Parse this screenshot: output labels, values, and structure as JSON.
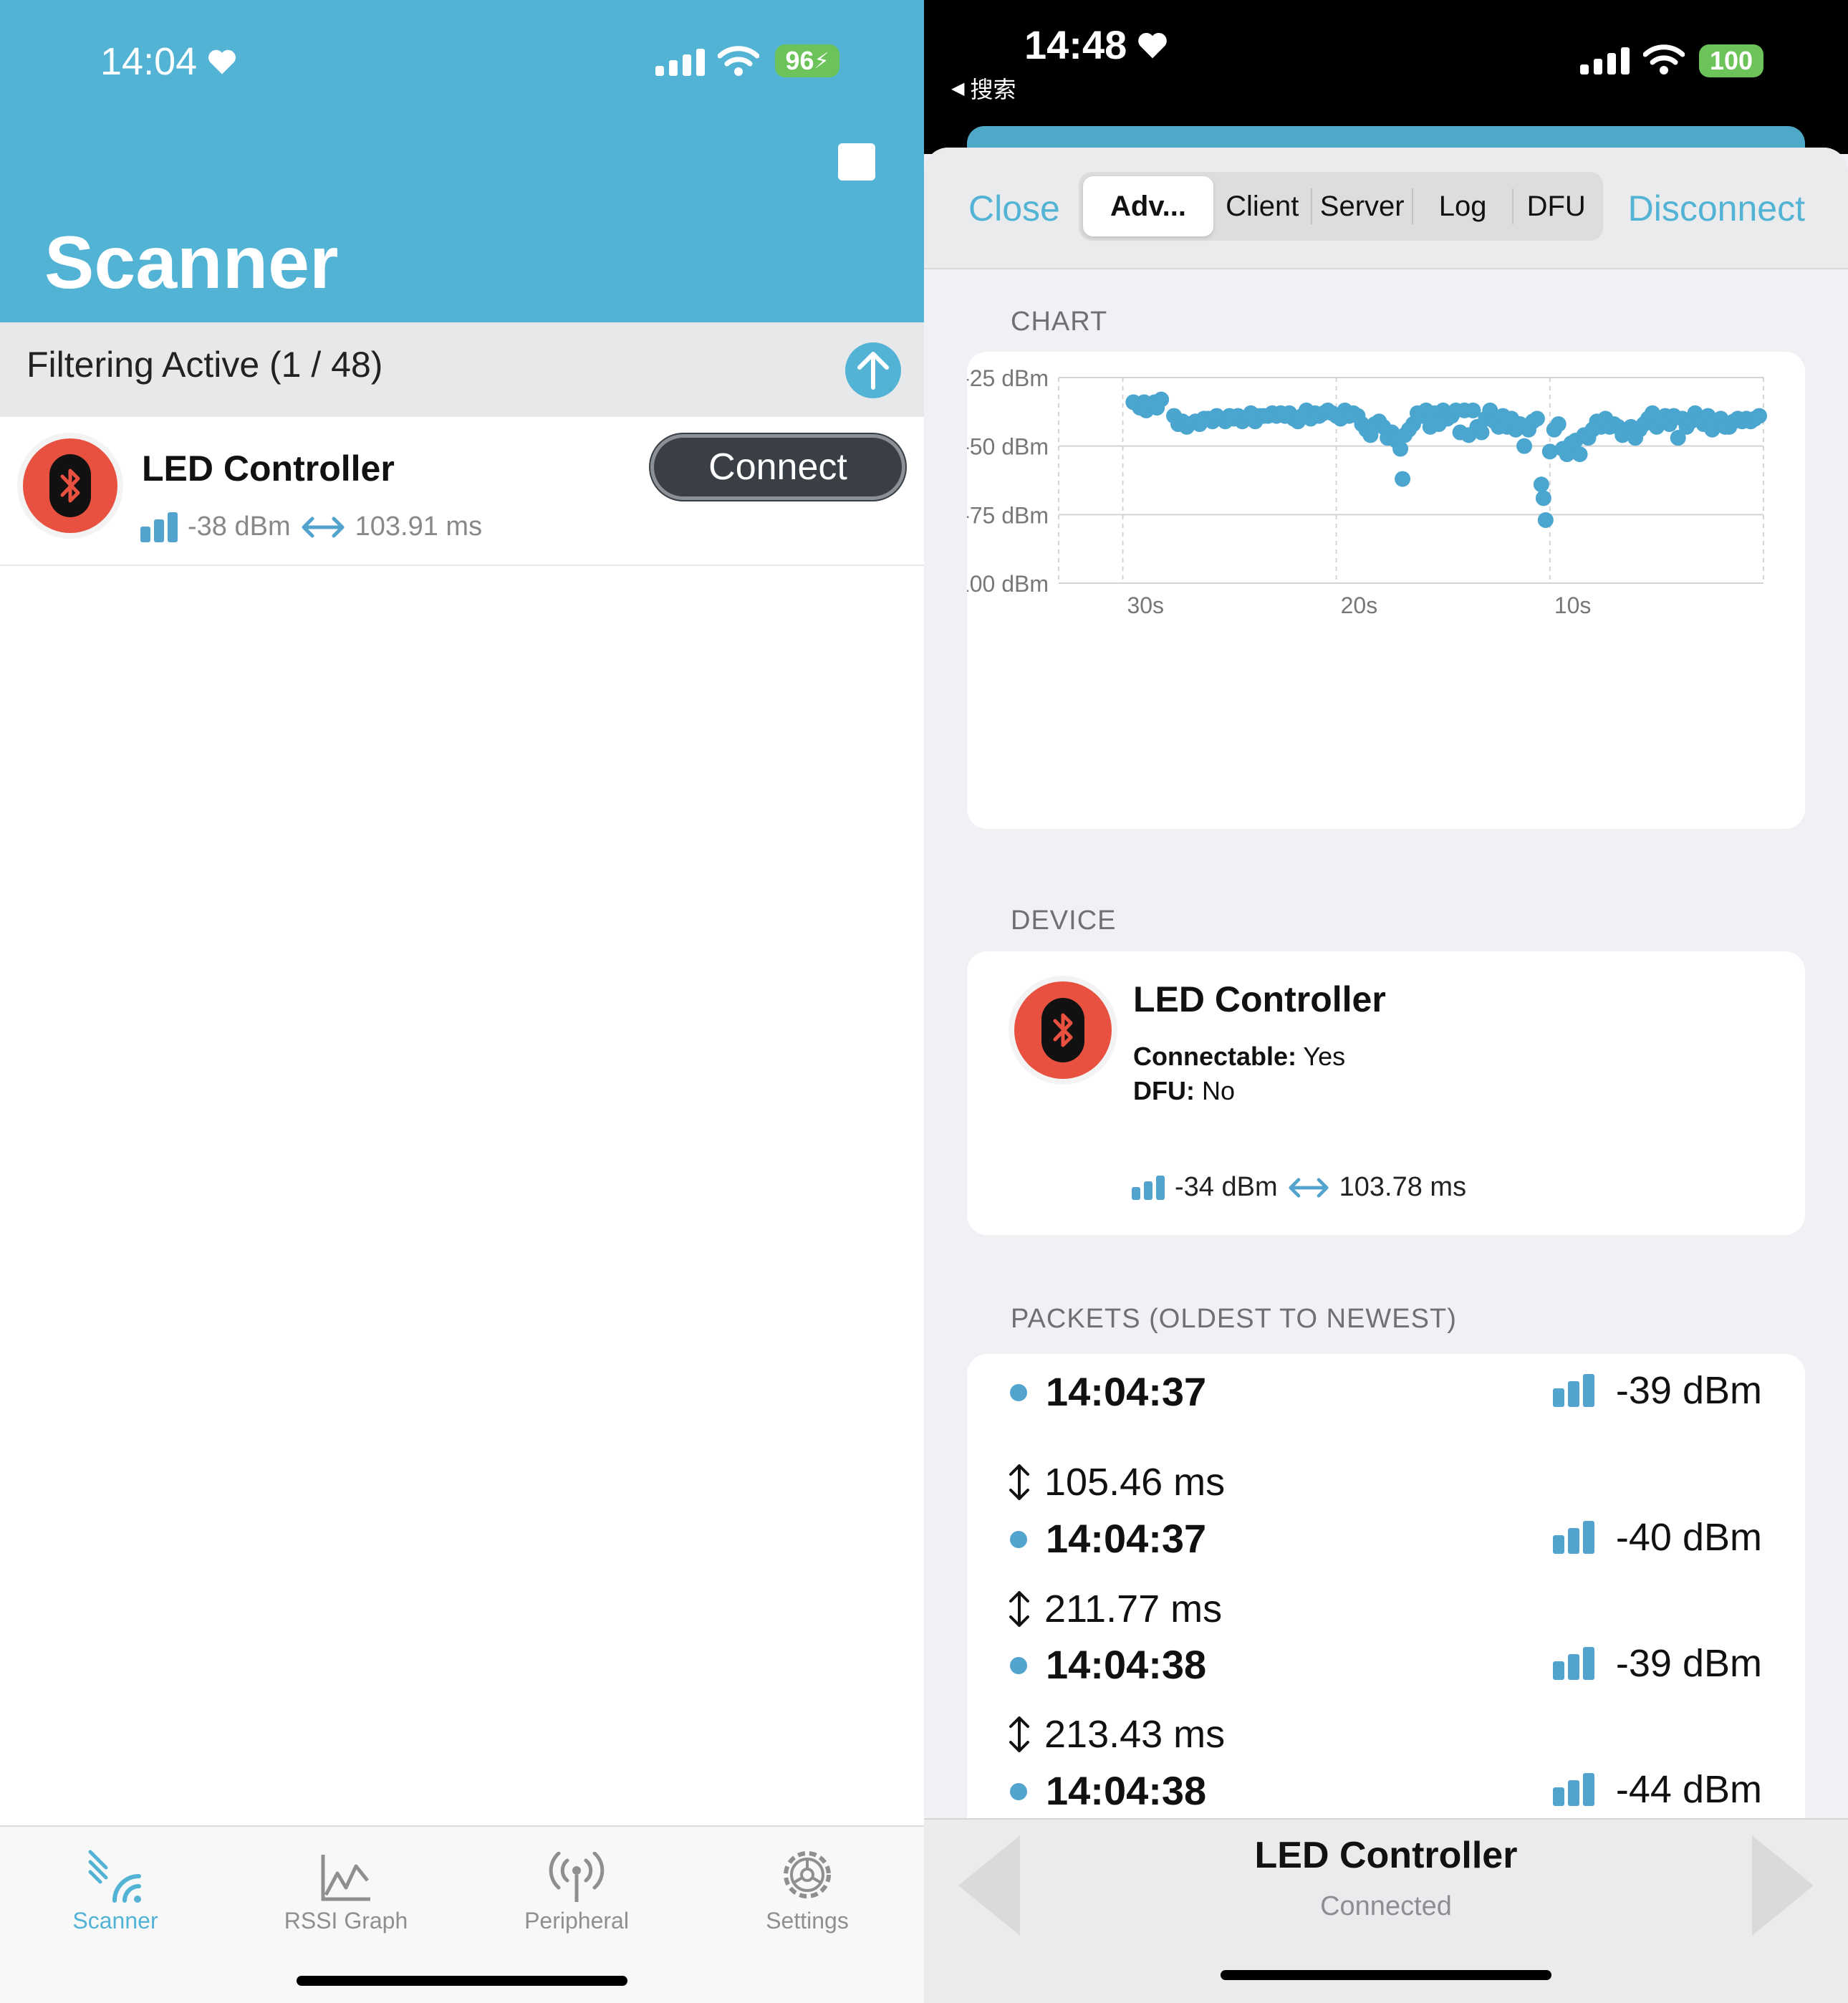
{
  "left": {
    "status": {
      "time": "14:04",
      "battery": "96"
    },
    "title": "Scanner",
    "filter": {
      "label": "Filtering Active (1 / 48)"
    },
    "device": {
      "name": "LED Controller",
      "rssi": "-38 dBm",
      "interval": "103.91 ms",
      "connect_label": "Connect"
    },
    "tabs": [
      {
        "label": "Scanner",
        "icon": "scanner-icon",
        "active": true
      },
      {
        "label": "RSSI Graph",
        "icon": "rssi-graph-icon",
        "active": false
      },
      {
        "label": "Peripheral",
        "icon": "peripheral-icon",
        "active": false
      },
      {
        "label": "Settings",
        "icon": "settings-gear-icon",
        "active": false
      }
    ],
    "colors": {
      "accent": "#53b3d5",
      "device_icon": "#e85040"
    }
  },
  "right": {
    "status": {
      "time": "14:48",
      "back_label": "搜索",
      "battery": "100"
    },
    "nav": {
      "close_label": "Close",
      "disconnect_label": "Disconnect",
      "segments": [
        "Adv...",
        "Client",
        "Server",
        "Log",
        "DFU"
      ],
      "selected_segment": "Adv..."
    },
    "chart_section_label": "CHART",
    "chart_data": {
      "type": "scatter",
      "title": "",
      "xlabel": "",
      "ylabel": "",
      "x_unit": "seconds ago",
      "xlim": [
        33,
        0
      ],
      "ylim": [
        -100,
        -25
      ],
      "x_ticks": [
        {
          "value": 30,
          "label": "30s"
        },
        {
          "value": 20,
          "label": "20s"
        },
        {
          "value": 10,
          "label": "10s"
        }
      ],
      "y_ticks": [
        {
          "value": -25,
          "label": "-25 dBm"
        },
        {
          "value": -50,
          "label": "-50 dBm"
        },
        {
          "value": -75,
          "label": "-75 dBm"
        },
        {
          "value": -100,
          "label": "-100 dBm"
        }
      ],
      "grid": true,
      "point_color": "#4aa5cf",
      "points": [
        [
          29.5,
          -34
        ],
        [
          29.2,
          -36
        ],
        [
          29.0,
          -34
        ],
        [
          28.9,
          -37
        ],
        [
          28.7,
          -35
        ],
        [
          28.5,
          -34
        ],
        [
          28.4,
          -36
        ],
        [
          28.2,
          -33
        ],
        [
          27.6,
          -39
        ],
        [
          27.4,
          -42
        ],
        [
          27.2,
          -41
        ],
        [
          27.0,
          -43
        ],
        [
          26.9,
          -42
        ],
        [
          26.6,
          -41
        ],
        [
          26.4,
          -42
        ],
        [
          26.2,
          -40
        ],
        [
          26.0,
          -40
        ],
        [
          25.8,
          -41
        ],
        [
          25.6,
          -39
        ],
        [
          25.4,
          -40
        ],
        [
          25.2,
          -41
        ],
        [
          25.0,
          -39
        ],
        [
          24.8,
          -40
        ],
        [
          24.6,
          -39
        ],
        [
          24.4,
          -41
        ],
        [
          24.2,
          -40
        ],
        [
          24.0,
          -38
        ],
        [
          23.8,
          -41
        ],
        [
          23.6,
          -39
        ],
        [
          23.4,
          -39
        ],
        [
          23.2,
          -39
        ],
        [
          23.0,
          -38
        ],
        [
          22.8,
          -39
        ],
        [
          22.6,
          -38
        ],
        [
          22.4,
          -39
        ],
        [
          22.2,
          -38
        ],
        [
          22.0,
          -40
        ],
        [
          21.8,
          -41
        ],
        [
          21.6,
          -39
        ],
        [
          21.4,
          -37
        ],
        [
          21.2,
          -40
        ],
        [
          21.0,
          -38
        ],
        [
          20.8,
          -39
        ],
        [
          20.6,
          -38
        ],
        [
          20.4,
          -37
        ],
        [
          20.2,
          -38
        ],
        [
          20.0,
          -39
        ],
        [
          19.8,
          -40
        ],
        [
          19.6,
          -37
        ],
        [
          19.4,
          -39
        ],
        [
          19.2,
          -38
        ],
        [
          19.0,
          -39
        ],
        [
          18.8,
          -42
        ],
        [
          18.6,
          -44
        ],
        [
          18.4,
          -46
        ],
        [
          18.2,
          -42
        ],
        [
          18.0,
          -41
        ],
        [
          17.8,
          -43
        ],
        [
          17.6,
          -47
        ],
        [
          17.4,
          -45
        ],
        [
          17.2,
          -48
        ],
        [
          17.0,
          -51
        ],
        [
          16.9,
          -62
        ],
        [
          16.8,
          -46
        ],
        [
          16.6,
          -44
        ],
        [
          16.4,
          -42
        ],
        [
          16.2,
          -38
        ],
        [
          16.0,
          -39
        ],
        [
          15.8,
          -37
        ],
        [
          15.6,
          -43
        ],
        [
          15.4,
          -38
        ],
        [
          15.2,
          -42
        ],
        [
          15.0,
          -37
        ],
        [
          14.8,
          -40
        ],
        [
          14.6,
          -39
        ],
        [
          14.4,
          -37
        ],
        [
          14.2,
          -45
        ],
        [
          14.0,
          -37
        ],
        [
          13.8,
          -46
        ],
        [
          13.6,
          -37
        ],
        [
          13.4,
          -43
        ],
        [
          13.2,
          -45
        ],
        [
          13.0,
          -40
        ],
        [
          12.8,
          -37
        ],
        [
          12.6,
          -41
        ],
        [
          12.4,
          -43
        ],
        [
          12.2,
          -39
        ],
        [
          12.0,
          -43
        ],
        [
          11.8,
          -40
        ],
        [
          11.6,
          -44
        ],
        [
          11.4,
          -42
        ],
        [
          11.2,
          -50
        ],
        [
          11.0,
          -44
        ],
        [
          10.8,
          -41
        ],
        [
          10.6,
          -40
        ],
        [
          10.4,
          -64
        ],
        [
          10.3,
          -69
        ],
        [
          10.2,
          -77
        ],
        [
          10.0,
          -52
        ],
        [
          9.8,
          -44
        ],
        [
          9.6,
          -42
        ],
        [
          9.4,
          -51
        ],
        [
          9.2,
          -53
        ],
        [
          9.0,
          -49
        ],
        [
          8.8,
          -48
        ],
        [
          8.6,
          -53
        ],
        [
          8.4,
          -46
        ],
        [
          8.2,
          -47
        ],
        [
          8.0,
          -44
        ],
        [
          7.8,
          -41
        ],
        [
          7.6,
          -43
        ],
        [
          7.4,
          -40
        ],
        [
          7.2,
          -43
        ],
        [
          7.0,
          -42
        ],
        [
          6.8,
          -43
        ],
        [
          6.6,
          -46
        ],
        [
          6.4,
          -44
        ],
        [
          6.2,
          -43
        ],
        [
          6.0,
          -47
        ],
        [
          5.8,
          -44
        ],
        [
          5.6,
          -42
        ],
        [
          5.4,
          -40
        ],
        [
          5.2,
          -38
        ],
        [
          5.0,
          -43
        ],
        [
          4.8,
          -41
        ],
        [
          4.6,
          -39
        ],
        [
          4.4,
          -42
        ],
        [
          4.2,
          -39
        ],
        [
          4.0,
          -47
        ],
        [
          3.8,
          -40
        ],
        [
          3.6,
          -43
        ],
        [
          3.4,
          -41
        ],
        [
          3.2,
          -38
        ],
        [
          3.0,
          -40
        ],
        [
          2.8,
          -42
        ],
        [
          2.6,
          -39
        ],
        [
          2.4,
          -44
        ],
        [
          2.2,
          -41
        ],
        [
          2.0,
          -40
        ],
        [
          1.8,
          -43
        ],
        [
          1.6,
          -43
        ],
        [
          1.4,
          -41
        ],
        [
          1.2,
          -40
        ],
        [
          1.0,
          -41
        ],
        [
          0.8,
          -40
        ],
        [
          0.6,
          -41
        ],
        [
          0.4,
          -40
        ],
        [
          0.2,
          -39
        ]
      ]
    },
    "device_section_label": "DEVICE",
    "device": {
      "name": "LED Controller",
      "connectable_key": "Connectable:",
      "connectable_val": " Yes",
      "dfu_key": "DFU:",
      "dfu_val": " No",
      "rssi": "-34 dBm",
      "interval": "103.78 ms"
    },
    "packets_section_label": "PACKETS (OLDEST TO NEWEST)",
    "packets": [
      {
        "time": "14:04:37",
        "rssi": "-39 dBm",
        "interval": "105.46 ms"
      },
      {
        "time": "14:04:37",
        "rssi": "-40 dBm",
        "interval": "211.77 ms"
      },
      {
        "time": "14:04:38",
        "rssi": "-39 dBm",
        "interval": "213.43 ms"
      },
      {
        "time": "14:04:38",
        "rssi": "-44 dBm",
        "interval": ""
      }
    ],
    "footer": {
      "name": "LED Controller",
      "status": "Connected"
    }
  }
}
